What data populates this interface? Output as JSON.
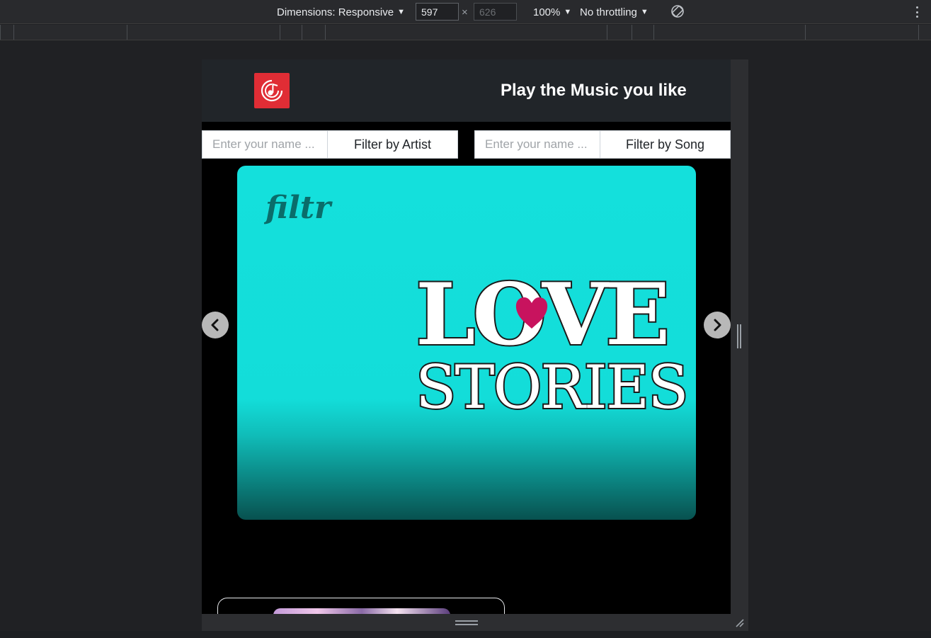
{
  "devtools": {
    "dimensions_label": "Dimensions: Responsive",
    "width_value": "597",
    "height_value": "626",
    "times_symbol": "×",
    "zoom_label": "100%",
    "throttling_label": "No throttling",
    "caret": "▼"
  },
  "header": {
    "title": "Play the Music you like",
    "logo_icon": "music-note-icon",
    "logo_color": "#e02d35"
  },
  "filters": {
    "artist": {
      "placeholder": "Enter your name ...",
      "button_label": "Filter by Artist"
    },
    "song": {
      "placeholder": "Enter your name ...",
      "button_label": "Filter by Song"
    }
  },
  "carousel": {
    "slide": {
      "brand_text": "filtr",
      "line1": "LOVE",
      "line2": "STORIES",
      "background_color": "#14e0dc",
      "heart_color": "#c8135e"
    },
    "prev_icon": "chevron-left-icon",
    "next_icon": "chevron-right-icon"
  }
}
